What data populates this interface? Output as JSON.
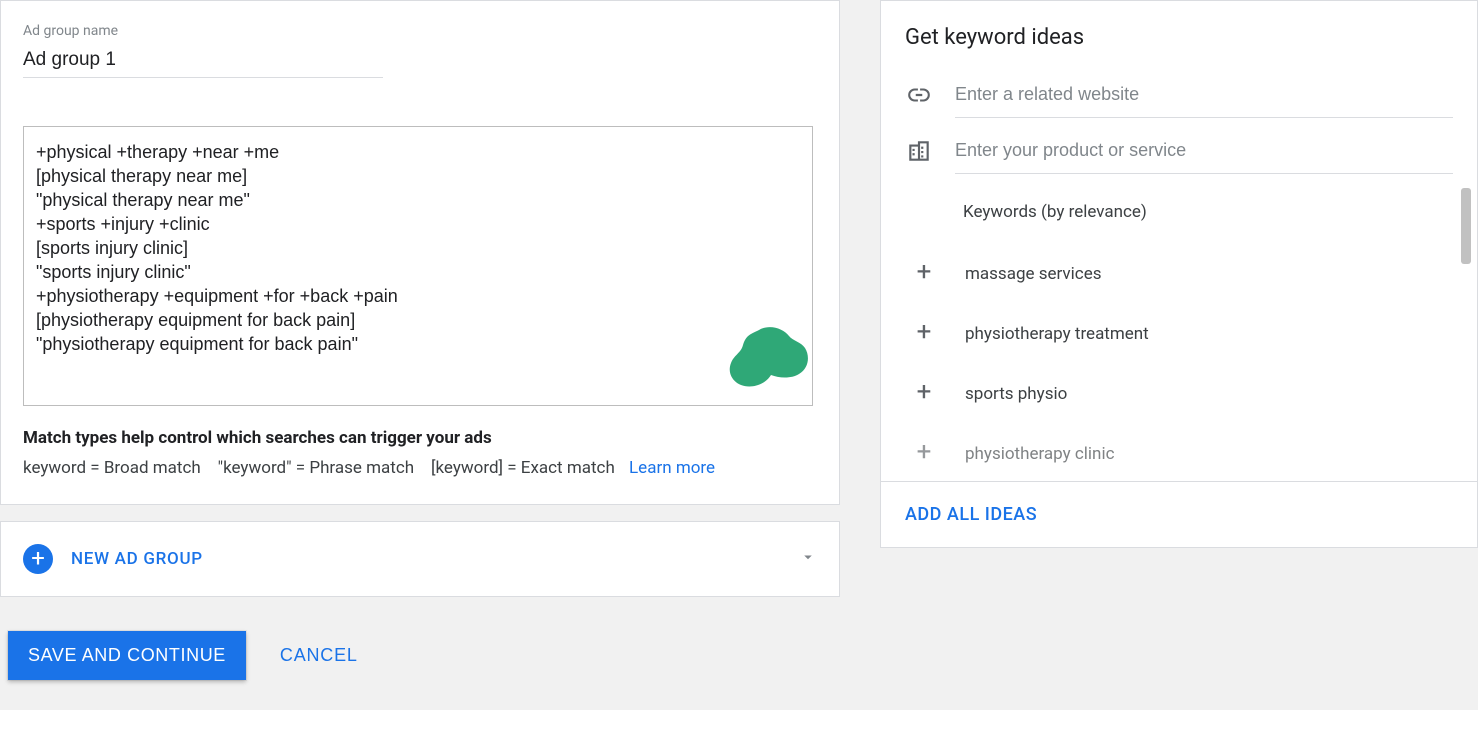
{
  "adGroup": {
    "label": "Ad group name",
    "value": "Ad group 1"
  },
  "keywordsTextarea": "+physical +therapy +near +me\n[physical therapy near me]\n\"physical therapy near me\"\n+sports +injury +clinic\n[sports injury clinic]\n\"sports injury clinic\"\n+physiotherapy +equipment +for +back +pain\n[physiotherapy equipment for back pain]\n\"physiotherapy equipment for back pain\"",
  "matchTypes": {
    "title": "Match types help control which searches can trigger your ads",
    "broad": "keyword = Broad match",
    "phrase": "\"keyword\" = Phrase match",
    "exact": "[keyword] = Exact match",
    "learnMore": "Learn more"
  },
  "ideasPanel": {
    "title": "Get keyword ideas",
    "websitePlaceholder": "Enter a related website",
    "productPlaceholder": "Enter your product or service",
    "listHeader": "Keywords (by relevance)",
    "suggestions": [
      "massage services",
      "physiotherapy treatment",
      "sports physio",
      "physiotherapy clinic"
    ],
    "addAll": "ADD ALL IDEAS"
  },
  "newAdGroup": "NEW AD GROUP",
  "footer": {
    "save": "SAVE AND CONTINUE",
    "cancel": "CANCEL"
  }
}
